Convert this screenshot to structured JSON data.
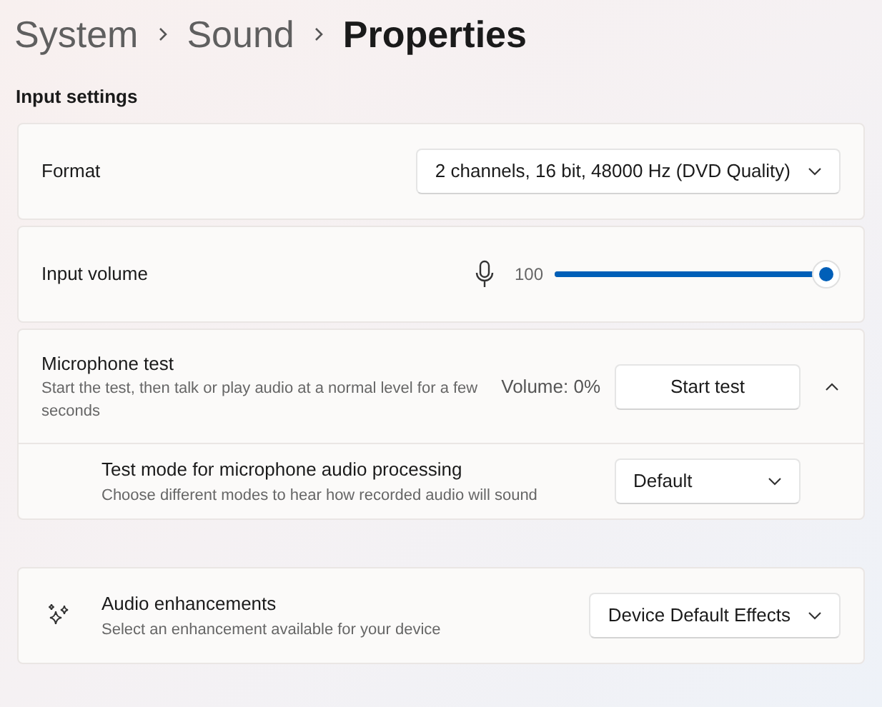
{
  "breadcrumb": [
    {
      "label": "System",
      "current": false
    },
    {
      "label": "Sound",
      "current": false
    },
    {
      "label": "Properties",
      "current": true
    }
  ],
  "section_title": "Input settings",
  "format": {
    "label": "Format",
    "value": "2 channels, 16 bit, 48000 Hz (DVD Quality)"
  },
  "input_volume": {
    "label": "Input volume",
    "reading": "100",
    "level": 1
  },
  "microphone_test": {
    "title": "Microphone test",
    "description": "Start the test, then talk or play audio at a normal level for a few seconds",
    "volume": "Volume: 0%",
    "button": "Start test",
    "expanded": true,
    "test_mode": {
      "title": "Test mode for microphone audio processing",
      "description": "Choose different modes to hear how recorded audio will sound",
      "value": "Default"
    }
  },
  "audio_enhancements": {
    "title": "Audio enhancements",
    "description": "Select an enhancement available for your device",
    "value": "Device Default Effects"
  }
}
